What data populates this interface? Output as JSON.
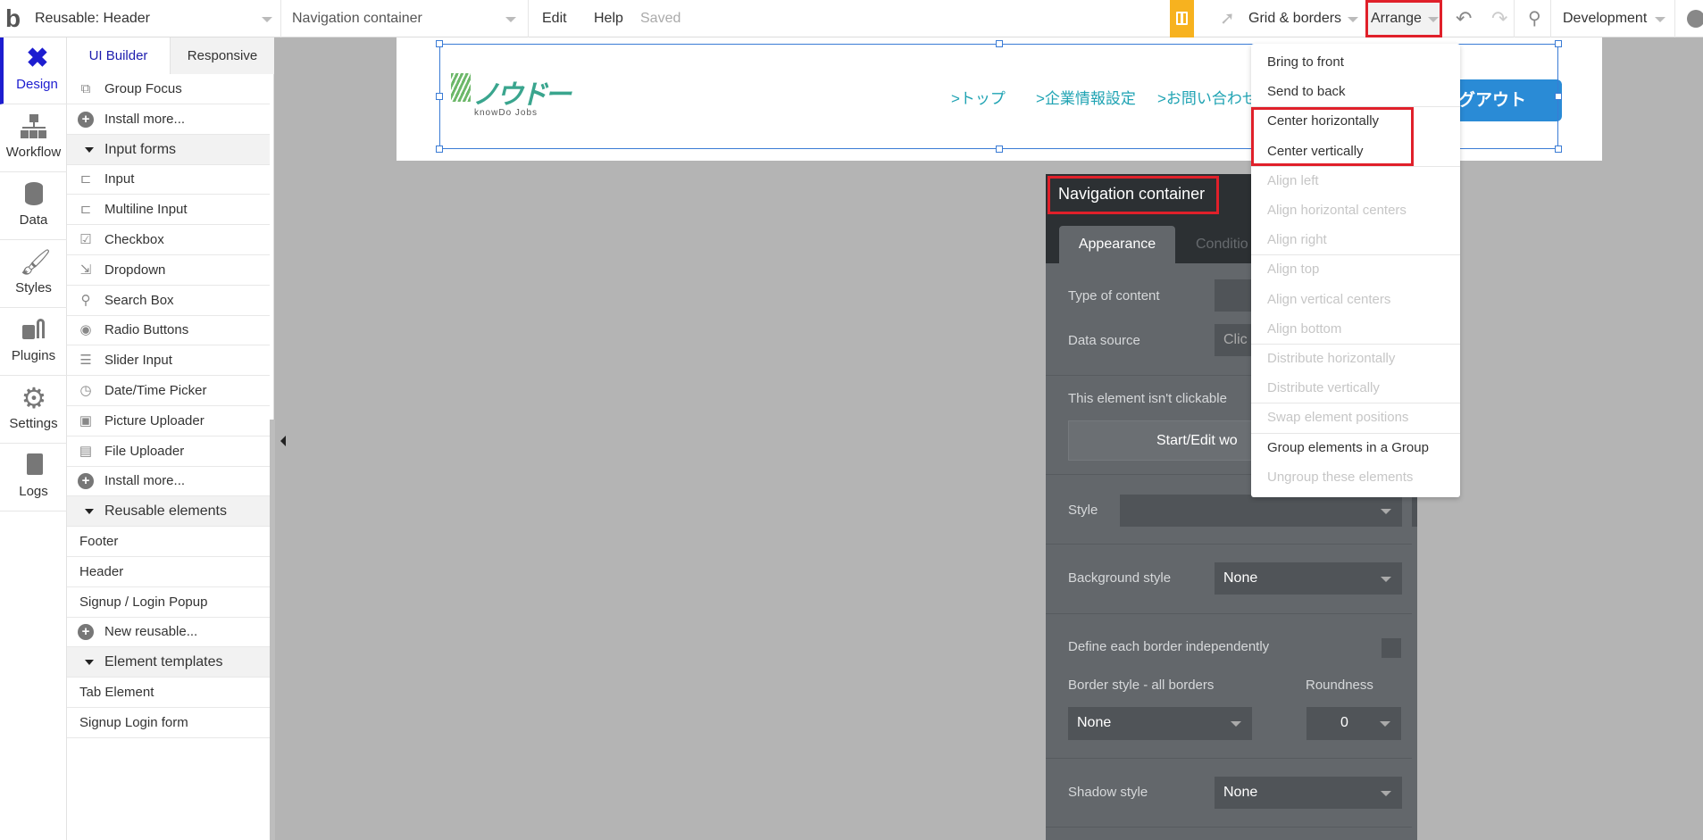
{
  "topbar": {
    "logo": "b",
    "page_select": "Reusable: Header",
    "element_select": "Navigation container",
    "edit": "Edit",
    "help": "Help",
    "saved": "Saved",
    "grid_borders": "Grid & borders",
    "arrange": "Arrange",
    "environment": "Development",
    "gift_color": "#f7b21f"
  },
  "leftnav": [
    {
      "label": "Design",
      "icon": "design-icon"
    },
    {
      "label": "Workflow",
      "icon": "workflow-icon"
    },
    {
      "label": "Data",
      "icon": "database-icon"
    },
    {
      "label": "Styles",
      "icon": "brush-icon"
    },
    {
      "label": "Plugins",
      "icon": "plug-icon"
    },
    {
      "label": "Settings",
      "icon": "gear-icon"
    },
    {
      "label": "Logs",
      "icon": "document-icon"
    }
  ],
  "panel": {
    "tabs": [
      "UI Builder",
      "Responsive"
    ],
    "rows": [
      {
        "label": "Group Focus",
        "icon": "group-focus-icon",
        "kind": "item"
      },
      {
        "label": "Install more...",
        "icon": "plus-circle-icon",
        "kind": "item"
      },
      {
        "label": "Input forms",
        "kind": "section"
      },
      {
        "label": "Input",
        "icon": "input-icon",
        "kind": "item"
      },
      {
        "label": "Multiline Input",
        "icon": "multiline-input-icon",
        "kind": "item"
      },
      {
        "label": "Checkbox",
        "icon": "checkbox-icon",
        "kind": "item"
      },
      {
        "label": "Dropdown",
        "icon": "dropdown-icon",
        "kind": "item"
      },
      {
        "label": "Search Box",
        "icon": "search-icon",
        "kind": "item"
      },
      {
        "label": "Radio Buttons",
        "icon": "radio-icon",
        "kind": "item"
      },
      {
        "label": "Slider Input",
        "icon": "slider-icon",
        "kind": "item"
      },
      {
        "label": "Date/Time Picker",
        "icon": "clock-icon",
        "kind": "item"
      },
      {
        "label": "Picture Uploader",
        "icon": "picture-icon",
        "kind": "item"
      },
      {
        "label": "File Uploader",
        "icon": "file-upload-icon",
        "kind": "item"
      },
      {
        "label": "Install more...",
        "icon": "plus-circle-icon",
        "kind": "item"
      },
      {
        "label": "Reusable elements",
        "kind": "section"
      },
      {
        "label": "Footer",
        "kind": "plain"
      },
      {
        "label": "Header",
        "kind": "plain"
      },
      {
        "label": "Signup / Login Popup",
        "kind": "plain"
      },
      {
        "label": "New reusable...",
        "icon": "plus-circle-icon",
        "kind": "item"
      },
      {
        "label": "Element templates",
        "kind": "section"
      },
      {
        "label": "Tab Element",
        "kind": "plain"
      },
      {
        "label": "Signup Login form",
        "kind": "plain"
      }
    ]
  },
  "canvas": {
    "logo_text": "ノウドー",
    "logo_sub": "knowDo Jobs",
    "nav_links": [
      ">トップ",
      ">企業情報設定",
      ">お問い合わせ"
    ],
    "logout": "ログアウト"
  },
  "arrange_menu": [
    {
      "label": "Bring to front",
      "enabled": true
    },
    {
      "label": "Send to back",
      "enabled": true
    },
    {
      "label": "Center horizontally",
      "enabled": true
    },
    {
      "label": "Center vertically",
      "enabled": true
    },
    {
      "label": "Align left",
      "enabled": false
    },
    {
      "label": "Align horizontal centers",
      "enabled": false
    },
    {
      "label": "Align right",
      "enabled": false
    },
    {
      "label": "Align top",
      "enabled": false
    },
    {
      "label": "Align vertical centers",
      "enabled": false
    },
    {
      "label": "Align bottom",
      "enabled": false
    },
    {
      "label": "Distribute horizontally",
      "enabled": false
    },
    {
      "label": "Distribute vertically",
      "enabled": false
    },
    {
      "label": "Swap element positions",
      "enabled": false
    },
    {
      "label": "Group elements in a Group",
      "enabled": true
    },
    {
      "label": "Ungroup these elements",
      "enabled": false
    }
  ],
  "property_editor": {
    "title": "Navigation container",
    "tabs": [
      "Appearance",
      "Conditio"
    ],
    "type_of_content": "Type of content",
    "data_source": "Data source",
    "data_source_value": "Clic",
    "not_clickable": "This element isn't clickable",
    "start_edit": "Start/Edit wo",
    "style_label": "Style",
    "style_value": "",
    "background_label": "Background style",
    "background_value": "None",
    "define_border": "Define each border independently",
    "border_style_label": "Border style - all borders",
    "border_style_value": "None",
    "roundness_label": "Roundness",
    "roundness_value": "0",
    "shadow_label": "Shadow style",
    "shadow_value": "None"
  }
}
